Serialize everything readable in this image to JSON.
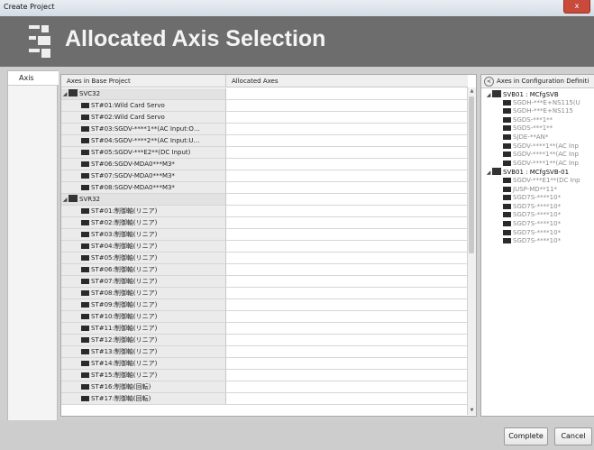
{
  "window": {
    "title": "Create Project",
    "close_label": "x"
  },
  "header": {
    "title": "Allocated Axis Selection",
    "logo_icon": "axis-grid-icon"
  },
  "nav": {
    "tab_axis": "Axis"
  },
  "table": {
    "col_base": "Axes in Base Project",
    "col_alloc": "Allocated Axes",
    "rows": [
      {
        "kind": "group",
        "label": "SVC32"
      },
      {
        "kind": "axis",
        "label": "ST#01:Wild Card Servo"
      },
      {
        "kind": "axis",
        "label": "ST#02:Wild Card Servo"
      },
      {
        "kind": "axis",
        "label": "ST#03:SGDV-****1**(AC Input:O…"
      },
      {
        "kind": "axis",
        "label": "ST#04:SGDV-****2**(AC Input:U…"
      },
      {
        "kind": "axis",
        "label": "ST#05:SGDV-***E2**(DC Input)"
      },
      {
        "kind": "axis",
        "label": "ST#06:SGDV-MDA0***M3*"
      },
      {
        "kind": "axis",
        "label": "ST#07:SGDV-MDA0***M3*"
      },
      {
        "kind": "axis",
        "label": "ST#08:SGDV-MDA0***M3*"
      },
      {
        "kind": "group",
        "label": "SVR32"
      },
      {
        "kind": "axis",
        "label": "ST#01:制御軸(リニア)"
      },
      {
        "kind": "axis",
        "label": "ST#02:制御軸(リニア)"
      },
      {
        "kind": "axis",
        "label": "ST#03:制御軸(リニア)"
      },
      {
        "kind": "axis",
        "label": "ST#04:制御軸(リニア)"
      },
      {
        "kind": "axis",
        "label": "ST#05:制御軸(リニア)"
      },
      {
        "kind": "axis",
        "label": "ST#06:制御軸(リニア)"
      },
      {
        "kind": "axis",
        "label": "ST#07:制御軸(リニア)"
      },
      {
        "kind": "axis",
        "label": "ST#08:制御軸(リニア)"
      },
      {
        "kind": "axis",
        "label": "ST#09:制御軸(リニア)"
      },
      {
        "kind": "axis",
        "label": "ST#10:制御軸(リニア)"
      },
      {
        "kind": "axis",
        "label": "ST#11:制御軸(リニア)"
      },
      {
        "kind": "axis",
        "label": "ST#12:制御軸(リニア)"
      },
      {
        "kind": "axis",
        "label": "ST#13:制御軸(リニア)"
      },
      {
        "kind": "axis",
        "label": "ST#14:制御軸(リニア)"
      },
      {
        "kind": "axis",
        "label": "ST#15:制御軸(リニア)"
      },
      {
        "kind": "axis",
        "label": "ST#16:制御軸(回転)"
      },
      {
        "kind": "axis",
        "label": "ST#17:制御軸(回転)"
      }
    ]
  },
  "config": {
    "header": "Axes in Configuration Definiti",
    "nodes": [
      {
        "kind": "group",
        "label": "SVB01 : MCfgSVB"
      },
      {
        "kind": "dev",
        "label": "SGDH-***E+NS115(U"
      },
      {
        "kind": "dev",
        "label": "SGDH-***E+NS115"
      },
      {
        "kind": "dev",
        "label": "SGDS-***1**"
      },
      {
        "kind": "dev",
        "label": "SGDS-***1**"
      },
      {
        "kind": "dev",
        "label": "SJDE-**AN*"
      },
      {
        "kind": "dev",
        "label": "SGDV-****1**(AC Inp"
      },
      {
        "kind": "dev",
        "label": "SGDV-****1**(AC Inp"
      },
      {
        "kind": "dev",
        "label": "SGDV-****1**(AC Inp"
      },
      {
        "kind": "group",
        "label": "SVB01 : MCfgSVB-01"
      },
      {
        "kind": "dev",
        "label": "SGDV-***E1**(DC Inp"
      },
      {
        "kind": "dev",
        "label": "JUSP-MD**11*"
      },
      {
        "kind": "dev",
        "label": "SGD7S-****10*"
      },
      {
        "kind": "dev",
        "label": "SGD7S-****10*"
      },
      {
        "kind": "dev",
        "label": "SGD7S-****10*"
      },
      {
        "kind": "dev",
        "label": "SGD7S-****10*"
      },
      {
        "kind": "dev",
        "label": "SGD7S-****10*"
      },
      {
        "kind": "dev",
        "label": "SGD7S-****10*"
      }
    ]
  },
  "footer": {
    "complete_label": "Complete",
    "cancel_label": "Cancel"
  }
}
